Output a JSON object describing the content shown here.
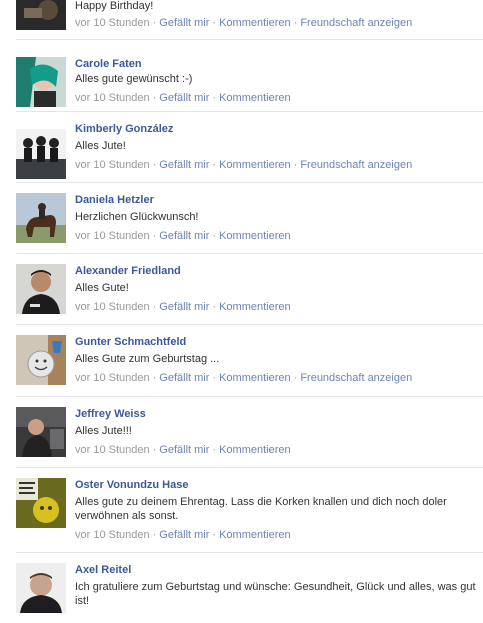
{
  "first_post": {
    "message": "Happy Birthday!",
    "time": "vor 10 Stunden",
    "like": "Gefällt mir",
    "comment": "Kommentieren",
    "friendship": "Freundschaft anzeigen"
  },
  "posts": [
    {
      "name": "Carole Faten",
      "message": "Alles gute gewünscht :-)",
      "time": "vor 10 Stunden",
      "like": "Gefällt mir",
      "comment": "Kommentieren",
      "friendship": ""
    },
    {
      "name": "Kimberly González",
      "message": "Alles Jute!",
      "time": "vor 10 Stunden",
      "like": "Gefällt mir",
      "comment": "Kommentieren",
      "friendship": "Freundschaft anzeigen"
    },
    {
      "name": "Daniela Hetzler",
      "message": "Herzlichen Glückwunsch!",
      "time": "vor 10 Stunden",
      "like": "Gefällt mir",
      "comment": "Kommentieren",
      "friendship": ""
    },
    {
      "name": "Alexander Friedland",
      "message": "Alles Gute!",
      "time": "vor 10 Stunden",
      "like": "Gefällt mir",
      "comment": "Kommentieren",
      "friendship": ""
    },
    {
      "name": "Gunter Schmachtfeld",
      "message": "Alles Gute zum Geburtstag ...",
      "time": "vor 10 Stunden",
      "like": "Gefällt mir",
      "comment": "Kommentieren",
      "friendship": "Freundschaft anzeigen"
    },
    {
      "name": "Jeffrey Weiss",
      "message": "Alles Jute!!!",
      "time": "vor 10 Stunden",
      "like": "Gefällt mir",
      "comment": "Kommentieren",
      "friendship": ""
    },
    {
      "name": "Oster Vonundzu Hase",
      "message": "Alles gute zu deinem Ehrentag. Lass die Korken knallen und dich noch doler verwöhnen als sonst.",
      "time": "vor 10 Stunden",
      "like": "Gefällt mir",
      "comment": "Kommentieren",
      "friendship": ""
    },
    {
      "name": "Axel Reitel",
      "message": "Ich gratuliere zum Geburtstag und wünsche: Gesundheit, Glück und alles, was gut ist!",
      "time": "",
      "like": "",
      "comment": "",
      "friendship": ""
    }
  ],
  "colors": {
    "link": "#3b5998",
    "action_link": "#6d84b4",
    "meta": "#999999",
    "divider": "#e4e6ea"
  },
  "icons": [
    "profile-photo-icon"
  ]
}
